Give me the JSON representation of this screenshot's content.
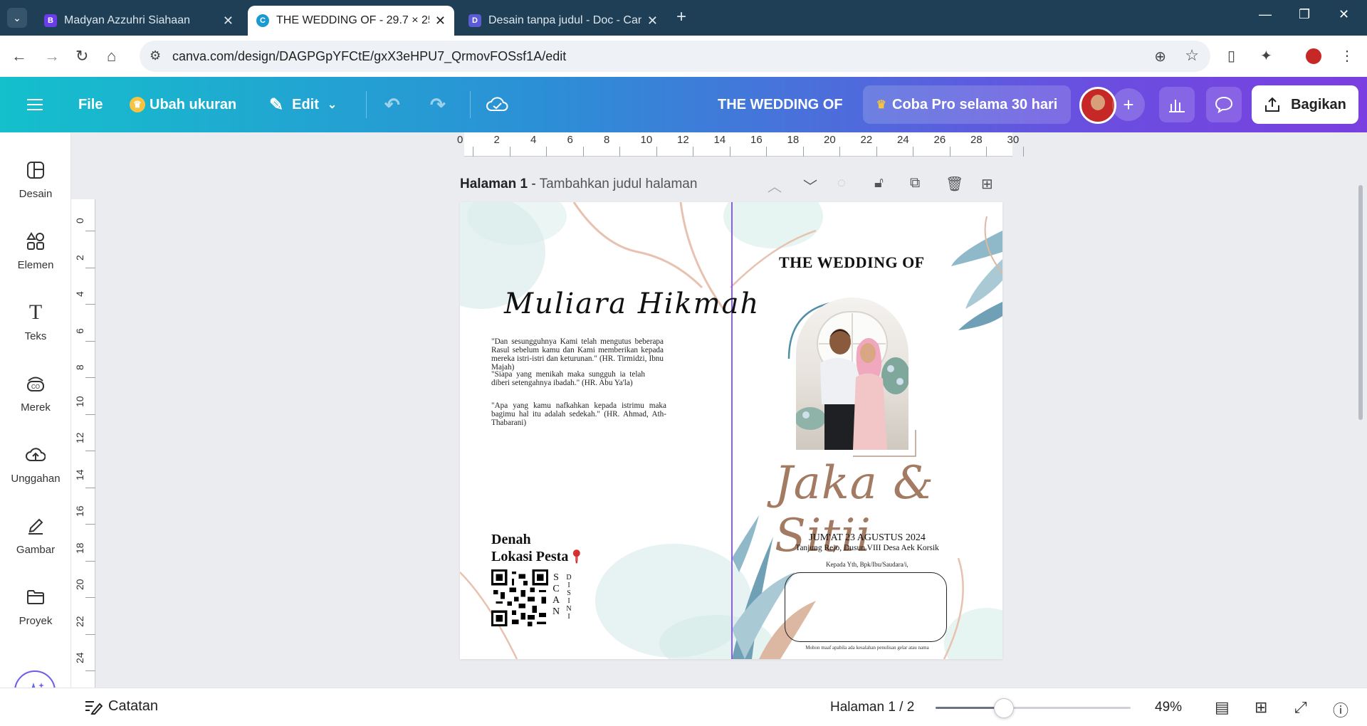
{
  "browser": {
    "tabs": [
      {
        "label": "Madyan Azzuhri Siahaan",
        "favicon": "B",
        "favicon_color": "#6a3de8",
        "active": false
      },
      {
        "label": "THE WEDDING OF - 29.7 × 25.1",
        "favicon": "C",
        "favicon_color": "#1b9ad1",
        "active": true
      },
      {
        "label": "Desain tanpa judul - Doc - Canva",
        "favicon": "D",
        "favicon_color": "#5b5bd6",
        "active": false
      }
    ],
    "new_tab": "+",
    "url": "canva.com/design/DAGPGpYFCtE/gxX3eHPU7_QrmovFOSsf1A/edit"
  },
  "header": {
    "menu_icon": "hamburger-icon",
    "file": "File",
    "resize": "Ubah ukuran",
    "edit": "Edit",
    "doc_title": "THE WEDDING OF",
    "pro": "Coba Pro selama 30 hari",
    "share": "Bagikan"
  },
  "sidebar": {
    "items": [
      {
        "label": "Desain",
        "icon": "layout-icon"
      },
      {
        "label": "Elemen",
        "icon": "shapes-icon"
      },
      {
        "label": "Teks",
        "icon": "text-icon"
      },
      {
        "label": "Merek",
        "icon": "brand-icon"
      },
      {
        "label": "Unggahan",
        "icon": "upload-cloud-icon"
      },
      {
        "label": "Gambar",
        "icon": "draw-icon"
      },
      {
        "label": "Proyek",
        "icon": "folder-icon"
      }
    ]
  },
  "ruler": {
    "top": [
      "0",
      "2",
      "4",
      "6",
      "8",
      "10",
      "12",
      "14",
      "16",
      "18",
      "20",
      "22",
      "24",
      "26",
      "28",
      "30"
    ],
    "left": [
      "0",
      "2",
      "4",
      "6",
      "8",
      "10",
      "12",
      "14",
      "16",
      "18",
      "20",
      "22",
      "24",
      "6"
    ]
  },
  "page": {
    "label": "Halaman 1",
    "separator": " - ",
    "title_placeholder": "Tambahkan judul halaman"
  },
  "design": {
    "left": {
      "script_title": "Muliara  Hikmah",
      "quotes": [
        "\"Dan sesungguhnya Kami telah mengutus beberapa Rasul sebelum kamu dan Kami memberikan kepada mereka istri-istri dan keturunan.\" (HR. Tirmidzi, Ibnu Majah)",
        "\"Siapa yang menikah maka sungguh ia telah diberi setengahnya ibadah.\" (HR. Abu Ya'la)",
        "\"Apa yang kamu nafkahkan kepada istrimu maka bagimu hal itu adalah sedekah.\" (HR. Ahmad, Ath-Thabarani)"
      ],
      "denah_line1": "Denah",
      "denah_line2": "Lokasi Pesta",
      "scan": [
        "S",
        "C",
        "A",
        "N"
      ],
      "disini": [
        "D",
        "I",
        "S",
        "I",
        "N",
        "I"
      ]
    },
    "right": {
      "title": "THE WEDDING OF",
      "names": "Jaka & Sitii",
      "date": "JUM'AT 23 AGUSTUS 2024",
      "address": "Tanjung Rejo, Dusun VIII Desa Aek Korsik",
      "greeting": "Kepada Yth, Bpk/Ibu/Saudara/i,",
      "footnote": "Mohon maaf apabila ada kesalahan penulisan gelar atau nama"
    }
  },
  "bottombar": {
    "notes": "Catatan",
    "page_count": "Halaman 1 / 2",
    "zoom_value": "49%",
    "zoom_fraction": 0.35
  },
  "colors": {
    "accent": "#8b5cf6",
    "gold_script": "#a37a62",
    "header_start": "#14c0cc",
    "header_end": "#7a3fe0"
  }
}
